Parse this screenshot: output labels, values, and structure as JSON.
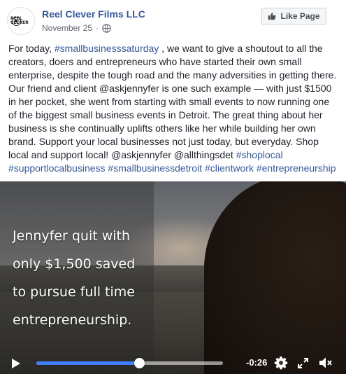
{
  "post": {
    "page_name": "Reel Clever Films LLC",
    "avatar_text": "REEL CLEVER",
    "date": "November 25",
    "date_separator": "·",
    "like_button_label": "Like Page",
    "text": {
      "p1": "For today, ",
      "h1": "#smallbusinesssaturday",
      "p2": " , we want to give a shoutout to all the creators, doers and entrepreneurs who have started their own small enterprise, despite the tough road and the many adversities in getting there. Our friend and client @askjennyfer is one such example — with just $1500 in her pocket, she went from starting with small events to now running one of the biggest small business events in Detroit. The great thing about her business is she continually uplifts others like her while building her own brand. Support your local businesses not just today, but everyday. Shop local and support local! @askjennyfer @allthingsdet ",
      "h2": "#shoplocal",
      "h3": "#supportlocalbusiness",
      "h4": "#smallbusinessdetroit",
      "h5": "#clientwork",
      "h6": "#entrepreneurship"
    }
  },
  "video": {
    "caption_lines": [
      "Jennyfer quit with",
      "only $1,500 saved",
      "to pursue full time",
      "entrepreneurship."
    ],
    "time_remaining": "-0:26",
    "progress": 0.55
  },
  "colors": {
    "link": "#365899",
    "progress_fill": "#4080ff"
  },
  "icons": [
    "globe-icon",
    "thumbs-up-icon",
    "play-icon",
    "settings-icon",
    "fullscreen-icon",
    "volume-icon"
  ]
}
